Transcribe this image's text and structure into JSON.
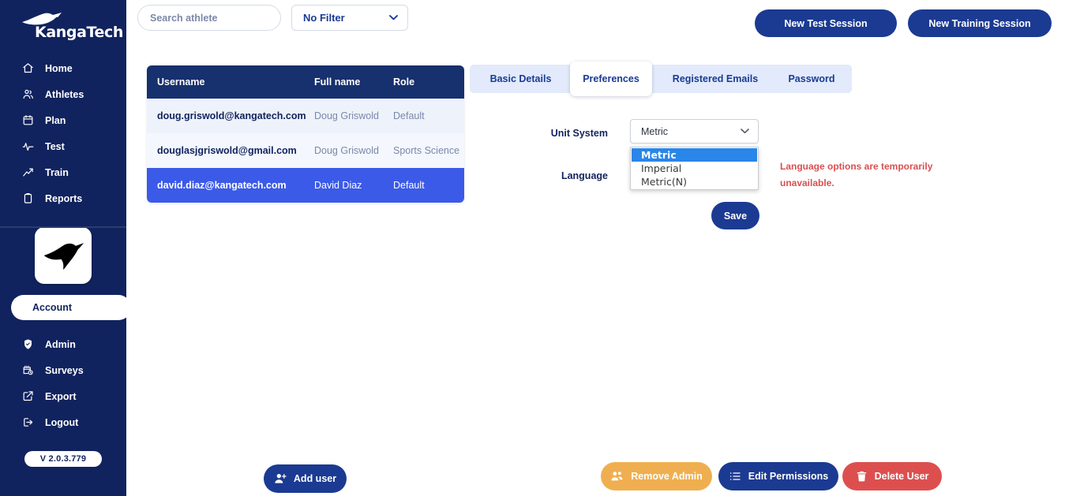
{
  "app": {
    "brand": "KangaTech",
    "version": "V 2.0.3.779"
  },
  "sidebar": {
    "primary_items": [
      {
        "label": "Home",
        "icon": "home-icon"
      },
      {
        "label": "Athletes",
        "icon": "people-icon"
      },
      {
        "label": "Plan",
        "icon": "calendar-icon"
      },
      {
        "label": "Test",
        "icon": "pulse-icon"
      },
      {
        "label": "Train",
        "icon": "trend-up-icon"
      },
      {
        "label": "Reports",
        "icon": "clipboard-icon"
      }
    ],
    "account_item": {
      "label": "Account",
      "icon": "user-icon",
      "active": true
    },
    "secondary_items": [
      {
        "label": "Admin",
        "icon": "shield-icon"
      },
      {
        "label": "Surveys",
        "icon": "survey-calendar-icon"
      },
      {
        "label": "Export",
        "icon": "export-icon"
      },
      {
        "label": "Logout",
        "icon": "logout-icon"
      }
    ]
  },
  "topbar": {
    "search_placeholder": "Search athlete",
    "search_value": "",
    "filter_selected": "No Filter",
    "filter_options": [
      "No Filter"
    ],
    "new_test_session": "New Test Session",
    "new_training_session": "New Training Session"
  },
  "user_table": {
    "columns": [
      "Username",
      "Full name",
      "Role"
    ],
    "rows": [
      {
        "username": "doug.griswold@kangatech.com",
        "full_name": "Doug Griswold",
        "role": "Default",
        "selected": false
      },
      {
        "username": "douglasjgriswold@gmail.com",
        "full_name": "Doug Griswold",
        "role": "Sports Science",
        "selected": false
      },
      {
        "username": "david.diaz@kangatech.com",
        "full_name": "David Diaz",
        "role": "Default",
        "selected": true
      }
    ]
  },
  "tabs": [
    {
      "label": "Basic Details",
      "active": false
    },
    {
      "label": "Preferences",
      "active": true
    },
    {
      "label": "Registered Emails",
      "active": false
    },
    {
      "label": "Password",
      "active": false
    }
  ],
  "preferences": {
    "unit_system_label": "Unit System",
    "unit_system_value": "Metric",
    "unit_system_open": true,
    "unit_system_options": [
      {
        "label": "Metric",
        "highlighted": true
      },
      {
        "label": "Imperial",
        "highlighted": false
      },
      {
        "label": "Metric(N)",
        "highlighted": false
      }
    ],
    "language_label": "Language",
    "language_warning": "Language options are temporarily unavailable.",
    "save_label": "Save"
  },
  "footer_actions": {
    "add_user": "Add user",
    "remove_admin": "Remove Admin",
    "edit_permissions": "Edit Permissions",
    "delete_user": "Delete User"
  },
  "colors": {
    "sidebar_navy": "#11235e",
    "brand_blue": "#1b3a92",
    "table_header": "#17306e",
    "row_selected": "#3b5ae8",
    "tabbar_bg": "#e2eafb",
    "warning_red": "#d94f52",
    "amber": "#efaf50",
    "danger_red": "#dd4f4f",
    "option_highlight": "#2a86e8"
  }
}
